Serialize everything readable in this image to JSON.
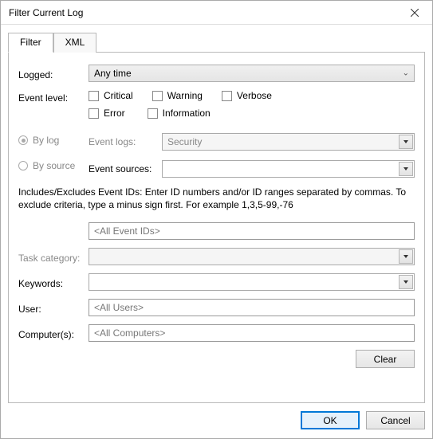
{
  "window": {
    "title": "Filter Current Log"
  },
  "tabs": {
    "filter": "Filter",
    "xml": "XML"
  },
  "labels": {
    "logged": "Logged:",
    "event_level": "Event level:",
    "by_log": "By log",
    "by_source": "By source",
    "event_logs": "Event logs:",
    "event_sources": "Event sources:",
    "task_category": "Task category:",
    "keywords": "Keywords:",
    "user": "User:",
    "computers": "Computer(s):"
  },
  "logged_value": "Any time",
  "levels": {
    "critical": "Critical",
    "warning": "Warning",
    "verbose": "Verbose",
    "error": "Error",
    "information": "Information"
  },
  "event_logs_value": "Security",
  "help_text": "Includes/Excludes Event IDs: Enter ID numbers and/or ID ranges separated by commas. To exclude criteria, type a minus sign first. For example 1,3,5-99,-76",
  "placeholders": {
    "event_ids": "<All Event IDs>",
    "user": "<All Users>",
    "computers": "<All Computers>"
  },
  "buttons": {
    "clear": "Clear",
    "ok": "OK",
    "cancel": "Cancel"
  }
}
